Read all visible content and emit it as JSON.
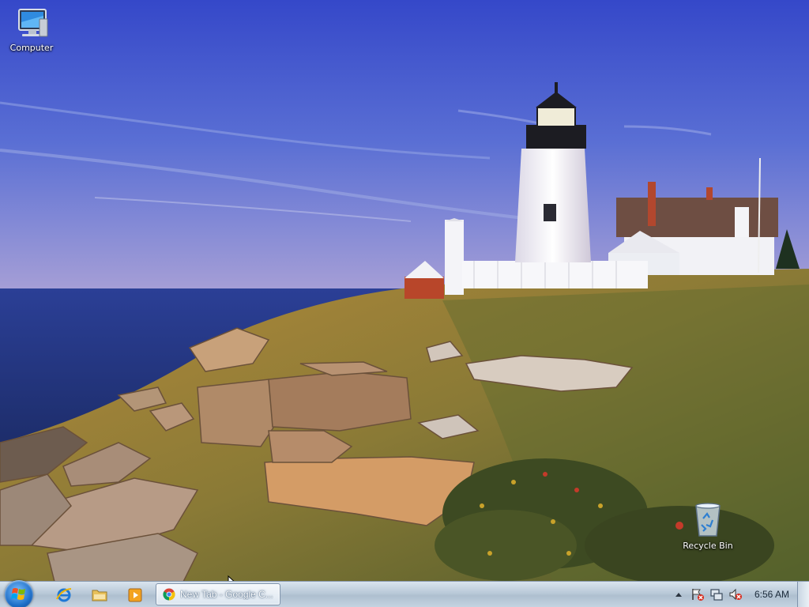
{
  "desktop": {
    "icons": [
      {
        "label": "Computer",
        "icon": "computer-icon"
      },
      {
        "label": "Recycle Bin",
        "icon": "recycle-bin-icon"
      }
    ]
  },
  "taskbar": {
    "start_icon": "windows-start-orb",
    "pinned": [
      {
        "name": "Internet Explorer",
        "icon": "internet-explorer-icon"
      },
      {
        "name": "Windows Explorer",
        "icon": "folder-icon"
      },
      {
        "name": "Windows Media Player",
        "icon": "media-player-icon"
      }
    ],
    "tasks": [
      {
        "label": "New Tab - Google C...",
        "icon": "chrome-icon"
      }
    ],
    "tray": {
      "icons": [
        "show-hidden-icons-arrow",
        "action-center-flag-icon",
        "network-icon",
        "volume-muted-icon"
      ],
      "clock": "6:56 AM"
    }
  },
  "colors": {
    "sky_top": "#3a4fc4",
    "sea": "#2a3e8c",
    "taskbar": "#c4d3e1"
  }
}
